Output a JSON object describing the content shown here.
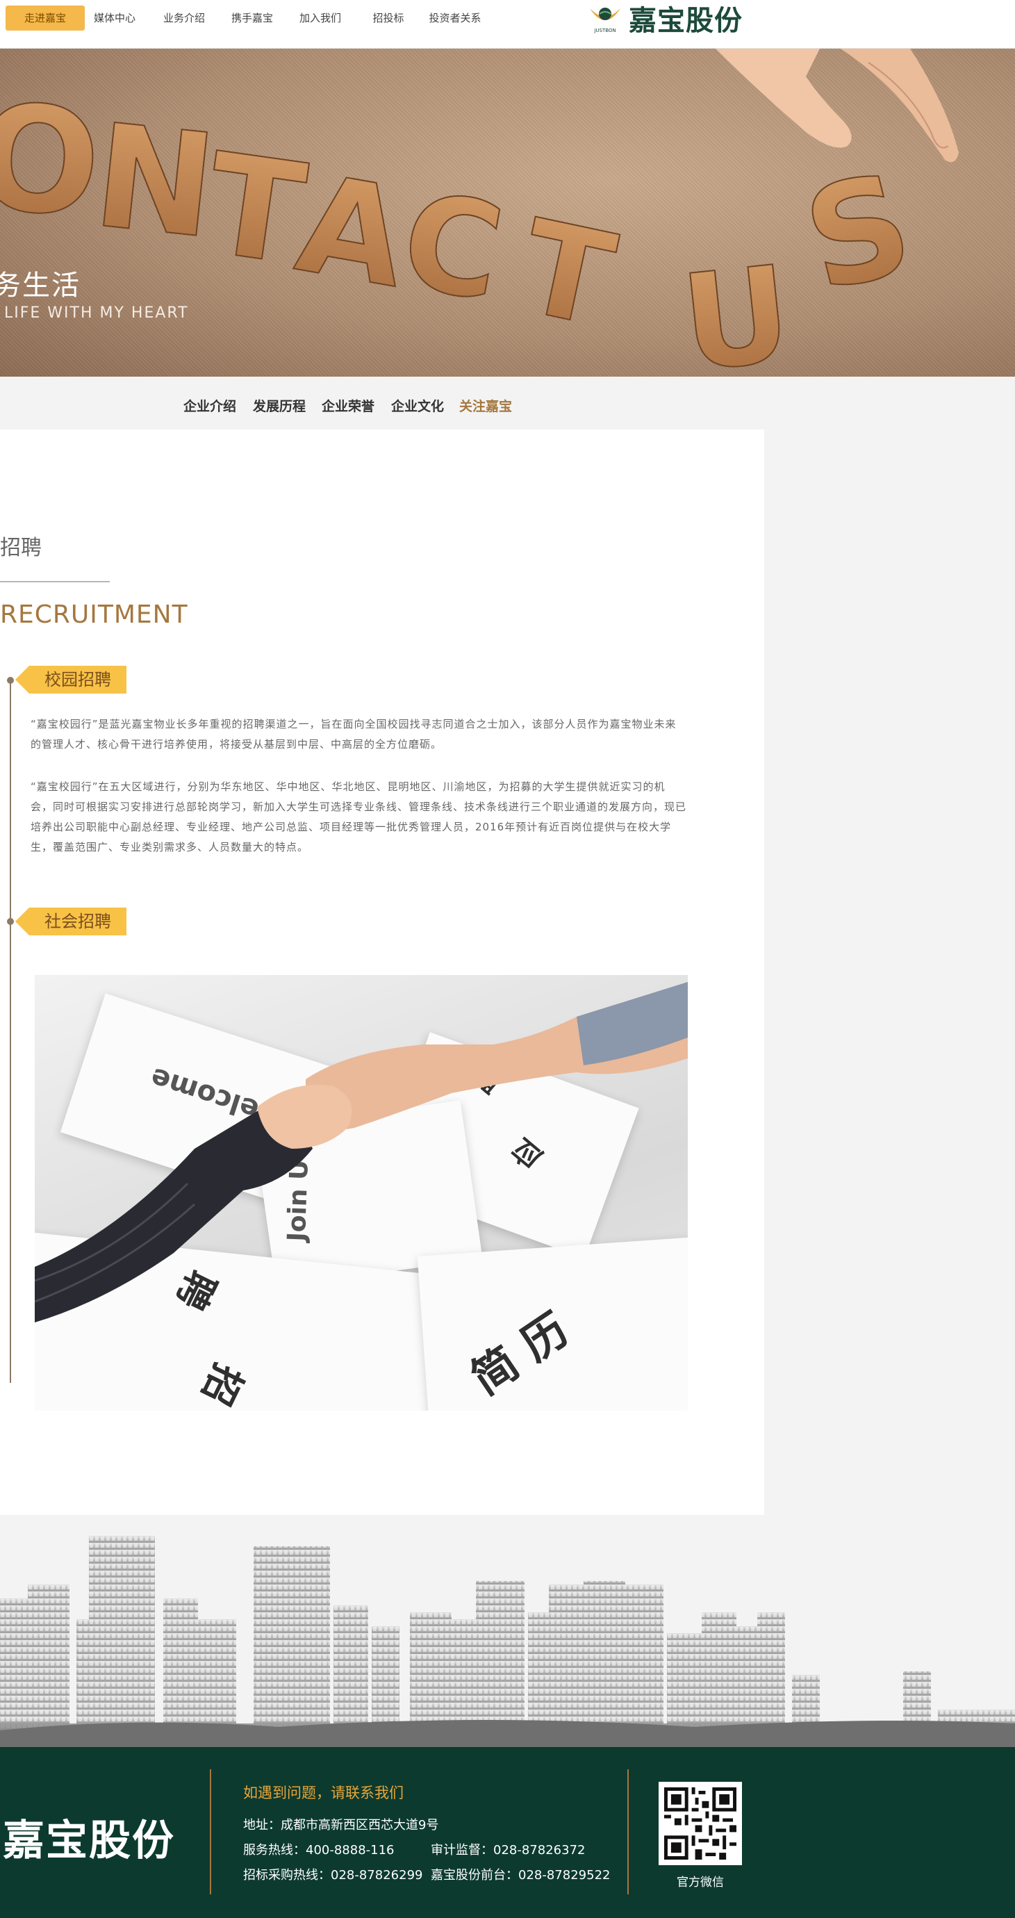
{
  "nav": {
    "items": [
      {
        "label": "走进嘉宝",
        "active": true
      },
      {
        "label": "媒体中心",
        "active": false
      },
      {
        "label": "业务介绍",
        "active": false
      },
      {
        "label": "携手嘉宝",
        "active": false
      },
      {
        "label": "加入我们",
        "active": false
      },
      {
        "label": "招投标",
        "active": false
      },
      {
        "label": "投资者关系",
        "active": false
      }
    ],
    "logo_text": "嘉宝股份",
    "logo_sub": "JUSTBON"
  },
  "banner": {
    "word": "CONTACT US",
    "cn": "务生活",
    "en": "LIFE WITH MY HEART"
  },
  "subnav": {
    "items": [
      {
        "label": "企业介绍",
        "active": false
      },
      {
        "label": "发展历程",
        "active": false
      },
      {
        "label": "企业荣誉",
        "active": false
      },
      {
        "label": "企业文化",
        "active": false
      },
      {
        "label": "关注嘉宝",
        "active": true
      }
    ]
  },
  "main": {
    "title_cn": "招聘",
    "title_en": "RECRUITMENT",
    "sections": [
      {
        "tag": "校园招聘",
        "paragraphs": [
          "“嘉宝校园行”是蓝光嘉宝物业长多年重视的招聘渠道之一，旨在面向全国校园找寻志同道合之士加入，该部分人员作为嘉宝物业未来的管理人才、核心骨干进行培养使用，将接受从基层到中层、中高层的全方位磨砺。",
          "“嘉宝校园行”在五大区域进行，分别为华东地区、华中地区、华北地区、昆明地区、川渝地区，为招募的大学生提供就近实习的机会，同时可根据实习安排进行总部轮岗学习，新加入大学生可选择专业条线、管理条线、技术条线进行三个职业通道的发展方向，现已培养出公司职能中心副总经理、专业经理、地产公司总监、项目经理等一批优秀管理人员，2016年预计有近百岗位提供与在校大学生，覆盖范围广、专业类别需求多、人员数量大的特点。"
        ]
      },
      {
        "tag": "社会招聘",
        "paragraphs": []
      }
    ],
    "photo_words": {
      "welcome": "Welcome",
      "join": "Join U",
      "resume": "简 历",
      "apply": "应",
      "recruit1": "聘",
      "recruit2": "招",
      "recruit3": "聘"
    }
  },
  "footer": {
    "logo_text": "嘉宝股份",
    "heading": "如遇到问题，请联系我们",
    "address": "地址：成都市高新西区西芯大道9号",
    "service_hotline": "服务热线：400-8888-116",
    "audit": "审计监督：028-87826372",
    "procurement": "招标采购热线：028-87826299",
    "front_desk": "嘉宝股份前台：028-87829522",
    "qr_label": "官方微信"
  },
  "colors": {
    "accent_gold": "#a5773f",
    "tag_yellow": "#f7c246",
    "footer_bg": "#0c3a2f",
    "nav_active": "#f5b84a"
  }
}
